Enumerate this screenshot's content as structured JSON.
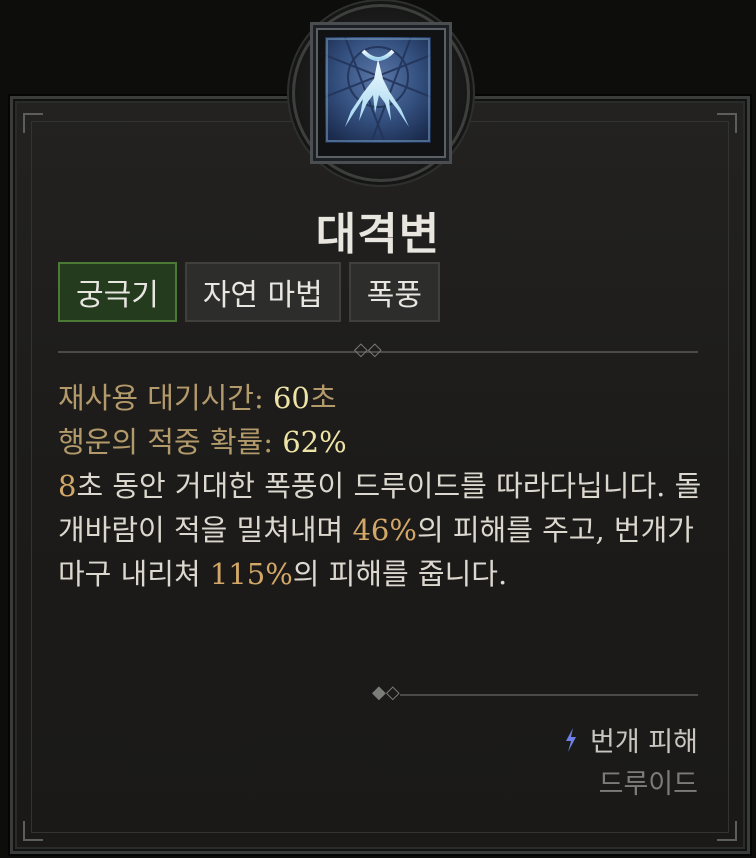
{
  "skill": {
    "name": "대격변",
    "tags": [
      "궁극기",
      "자연 마법",
      "폭풍"
    ],
    "cooldown_label": "재사용 대기시간:",
    "cooldown_value": "60",
    "cooldown_unit": "초",
    "crit_label": "행운의 적중 확률:",
    "crit_value": "62%",
    "desc": {
      "p1_num": "8",
      "p1_text": "초 동안 거대한 폭풍이 드루이드를 따라다닙니다. 돌개바람이 적을 밀쳐내며 ",
      "p2_num": "46%",
      "p2_text": "의 피해를 주고, 번개가 마구 내리쳐 ",
      "p3_num": "115%",
      "p3_text": "의 피해를 줍니다."
    },
    "damage_type": "번개 피해",
    "damage_icon": "lightning-icon",
    "class_name": "드루이드"
  },
  "colors": {
    "primary_tag": "#243b1d",
    "stat_label": "#b39a6b",
    "highlight_value": "#eee3a6",
    "number": "#d2a768",
    "lightning": "#6f7fe8"
  }
}
